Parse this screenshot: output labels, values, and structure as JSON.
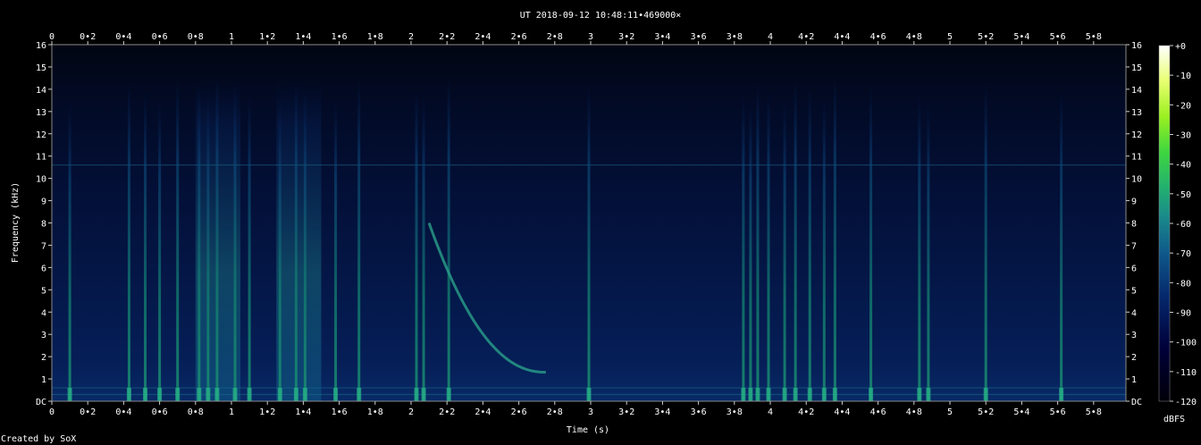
{
  "title": "UT 2018-09-12 10:48:11•469000×",
  "footer": "Created by SoX",
  "colors": {
    "background": "#000000",
    "text": "#ffffff",
    "frame": "#8a8a8a"
  },
  "chart_data": {
    "type": "heatmap",
    "title": "UT 2018-09-12 10:48:11•469000×",
    "xlabel": "Time (s)",
    "ylabel": "Frequency (kHz)",
    "xlim": [
      0,
      5.98
    ],
    "ylim": [
      0,
      16
    ],
    "x_ticks": [
      "0",
      "0•2",
      "0•4",
      "0•6",
      "0•8",
      "1",
      "1•2",
      "1•4",
      "1•6",
      "1•8",
      "2",
      "2•2",
      "2•4",
      "2•6",
      "2•8",
      "3",
      "3•2",
      "3•4",
      "3•6",
      "3•8",
      "4",
      "4•2",
      "4•4",
      "4•6",
      "4•8",
      "5",
      "5•2",
      "5•4",
      "5•6",
      "5•8"
    ],
    "y_ticks": [
      "DC",
      "1",
      "2",
      "3",
      "4",
      "5",
      "6",
      "7",
      "8",
      "9",
      "10",
      "11",
      "12",
      "13",
      "14",
      "15",
      "16"
    ],
    "colorbar": {
      "label": "dBFS",
      "range": [
        -120,
        0
      ],
      "ticks": [
        "+0",
        "-10",
        "-20",
        "-30",
        "-40",
        "-50",
        "-60",
        "-70",
        "-80",
        "-90",
        "-100",
        "-110",
        "-120"
      ],
      "colors": [
        "#000008",
        "#00003a",
        "#052a6e",
        "#0f5a8a",
        "#1a8a8a",
        "#22b070",
        "#3ed640",
        "#9af020",
        "#e8ff70",
        "#ffffff"
      ]
    },
    "features": {
      "impulses_s": [
        0.1,
        0.43,
        0.52,
        0.6,
        0.7,
        0.82,
        0.87,
        0.92,
        1.02,
        1.1,
        1.27,
        1.36,
        1.41,
        1.58,
        1.71,
        2.03,
        2.07,
        2.21,
        2.99,
        3.85,
        3.89,
        3.93,
        3.99,
        4.08,
        4.14,
        4.22,
        4.3,
        4.36,
        4.56,
        4.83,
        4.88,
        5.2,
        5.62
      ],
      "noise_bursts_s": [
        [
          0.8,
          1.05
        ],
        [
          1.25,
          1.5
        ]
      ],
      "whistler": {
        "start_s": 2.1,
        "end_s": 2.75,
        "start_khz": 8.0,
        "end_khz": 1.3
      },
      "tone_lines_khz": [
        0.3,
        0.6,
        10.6
      ]
    }
  }
}
